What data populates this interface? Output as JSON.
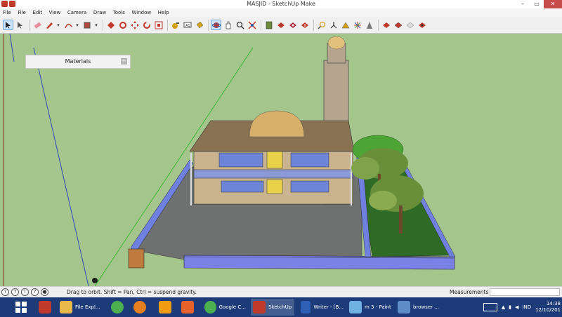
{
  "window": {
    "title": "MASJID - SketchUp Make",
    "min": "–",
    "max": "▭",
    "close": "✕"
  },
  "menu": [
    "File",
    "File",
    "Edit",
    "View",
    "Camera",
    "Draw",
    "Tools",
    "Window",
    "Help"
  ],
  "toolbar": {
    "tools": [
      "select-icon",
      "cursor-icon",
      "eraser-icon",
      "pencil-icon",
      "arc-icon",
      "rectangle-icon",
      "push-pull-icon",
      "follow-me-icon",
      "move-icon",
      "rotate-icon",
      "scale-icon",
      "tape-measure-icon",
      "text-icon",
      "paint-bucket-icon",
      "orbit-icon",
      "pan-icon",
      "zoom-icon",
      "zoom-extents-icon",
      "section-icon",
      "warehouse-icon",
      "extension-icon",
      "share-icon",
      "position-camera-icon",
      "walk-icon",
      "look-around-icon",
      "axes-icon",
      "sandbox-icon",
      "style-icon",
      "style2-icon",
      "style3-icon",
      "style4-icon"
    ],
    "selected": "orbit-icon"
  },
  "materials_panel": {
    "label": "Materials",
    "expand": "+"
  },
  "statusbar": {
    "hint": "Drag to orbit. Shift = Pan, Ctrl = suspend gravity.",
    "measurements_label": "Measurements",
    "measurements_value": ""
  },
  "taskbar": {
    "items": [
      {
        "icon": "windows-start-icon",
        "label": "",
        "color": "#1c3b78"
      },
      {
        "icon": "power-icon",
        "label": "",
        "color": "#c0392b"
      },
      {
        "icon": "folder-icon",
        "label": "File Expl...",
        "color": "#e8b84a"
      },
      {
        "icon": "chrome-icon",
        "label": "",
        "color": "#4caf50"
      },
      {
        "icon": "firefox-icon",
        "label": "",
        "color": "#e67e22"
      },
      {
        "icon": "vlc-icon",
        "label": "",
        "color": "#f39c12"
      },
      {
        "icon": "presentation-icon",
        "label": "",
        "color": "#e8632c"
      },
      {
        "icon": "chrome-icon",
        "label": "Google C...",
        "color": "#4caf50"
      },
      {
        "icon": "sketchup-icon",
        "label": "SketchUp",
        "color": "#c0392b"
      },
      {
        "icon": "writer-icon",
        "label": "Writer - [B...",
        "color": "#2d5fb4"
      },
      {
        "icon": "paint-icon",
        "label": "m 3 - Paint",
        "color": "#6fb1e0"
      },
      {
        "icon": "browser-icon",
        "label": "browser ...",
        "color": "#5d8cc7"
      }
    ],
    "tray": {
      "lang": "IND",
      "time": "14:38",
      "date": "12/10/201"
    }
  }
}
